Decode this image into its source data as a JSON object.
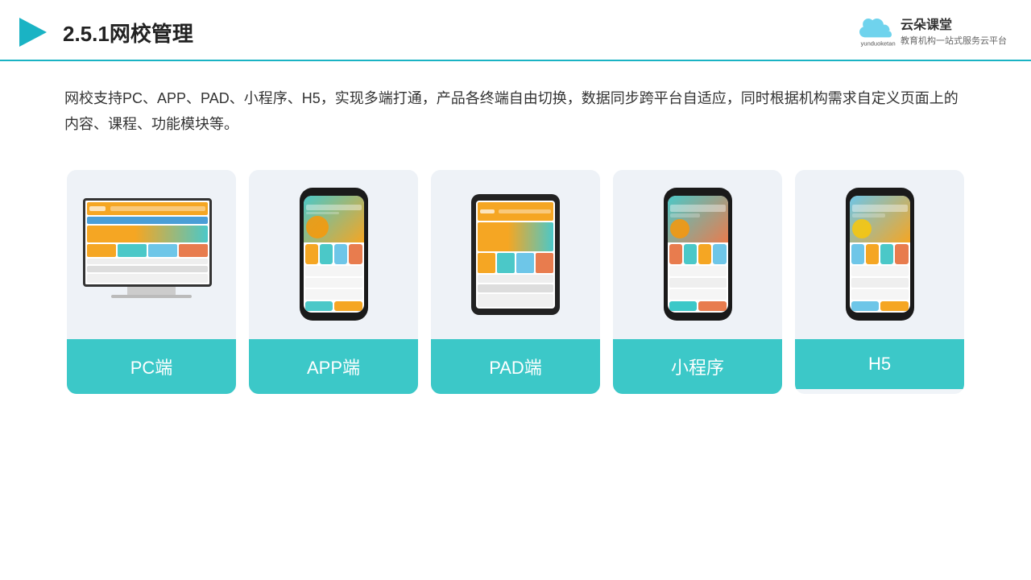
{
  "header": {
    "title": "2.5.1网校管理",
    "brand": {
      "name": "云朵课堂",
      "url": "yunduoketang.com",
      "tagline": "教育机构一站式服务云平台"
    }
  },
  "description": "网校支持PC、APP、PAD、小程序、H5，实现多端打通，产品各终端自由切换，数据同步跨平台自适应，同时根据机构需求自定义页面上的内容、课程、功能模块等。",
  "cards": [
    {
      "id": "pc",
      "label": "PC端",
      "type": "desktop"
    },
    {
      "id": "app",
      "label": "APP端",
      "type": "phone"
    },
    {
      "id": "pad",
      "label": "PAD端",
      "type": "tablet"
    },
    {
      "id": "miniprogram",
      "label": "小程序",
      "type": "phone"
    },
    {
      "id": "h5",
      "label": "H5",
      "type": "phone"
    }
  ],
  "colors": {
    "accent": "#3cc8c8",
    "header_border": "#1ab3c4",
    "card_bg": "#eef2f7",
    "label_bg": "#3cc8c8"
  }
}
